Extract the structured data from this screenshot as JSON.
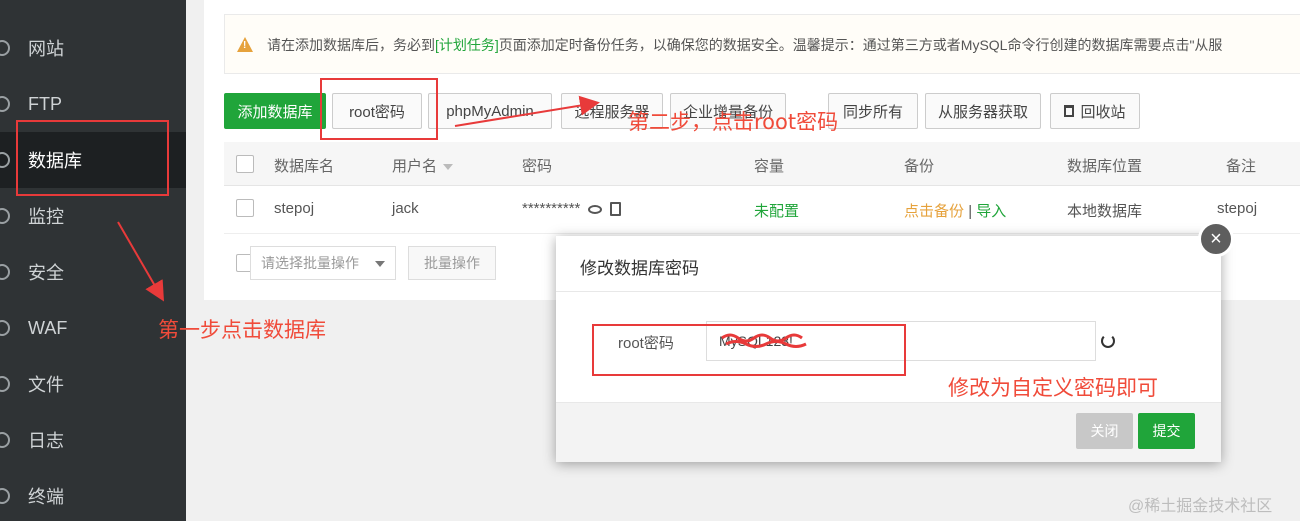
{
  "sidebar": {
    "items": [
      {
        "label": "网站",
        "icon": "globe-icon"
      },
      {
        "label": "FTP",
        "icon": "ftp-icon"
      },
      {
        "label": "数据库",
        "icon": "database-icon"
      },
      {
        "label": "监控",
        "icon": "monitor-icon"
      },
      {
        "label": "安全",
        "icon": "shield-icon"
      },
      {
        "label": "WAF",
        "icon": "waf-shield-icon"
      },
      {
        "label": "文件",
        "icon": "folder-icon"
      },
      {
        "label": "日志",
        "icon": "log-icon"
      },
      {
        "label": "终端",
        "icon": "terminal-icon"
      }
    ],
    "active": "数据库"
  },
  "notice": {
    "prefix": "请在添加数据库后，务必到",
    "link": "[计划任务]",
    "suffix": "页面添加定时备份任务，以确保您的数据安全。温馨提示：通过第三方或者MySQL命令行创建的数据库需要点击\"从服"
  },
  "toolbar": {
    "add": "添加数据库",
    "root_password": "root密码",
    "phpmyadmin": "phpMyAdmin",
    "remote": "远程服务器",
    "enterprise_backup": "企业增量备份",
    "sync_all": "同步所有",
    "fetch_from_server": "从服务器获取",
    "recycle_bin": "回收站"
  },
  "table": {
    "headers": [
      "数据库名",
      "用户名",
      "密码",
      "容量",
      "备份",
      "数据库位置",
      "备注"
    ],
    "rows": [
      {
        "name": "stepoj",
        "user": "jack",
        "password": "**********",
        "capacity": "未配置",
        "backup_action": "点击备份",
        "separator": "|",
        "import_action": "导入",
        "location": "本地数据库",
        "note": "stepoj"
      }
    ]
  },
  "batch": {
    "select_placeholder": "请选择批量操作",
    "button": "批量操作"
  },
  "modal": {
    "title": "修改数据库密码",
    "close": "×",
    "field_label": "root密码",
    "password_value": "MySQL123!",
    "close_button": "关闭",
    "submit_button": "提交"
  },
  "annotations": {
    "step1": "第一步点击数据库",
    "step2": "第二步，点击root密码",
    "hint": "修改为自定义密码即可",
    "color": "#f04b3a"
  },
  "watermark": "@稀土掘金技术社区",
  "colors": {
    "brand_green": "#20a53a",
    "sidebar_bg": "#2f3335",
    "warning": "#e6a23c"
  }
}
